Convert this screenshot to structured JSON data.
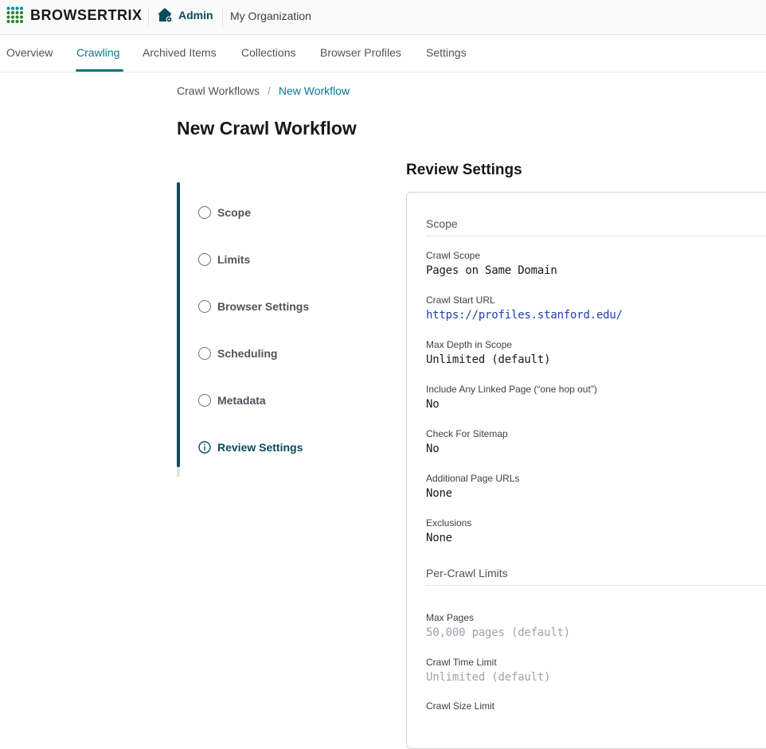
{
  "header": {
    "brand": "BROWSERTRIX",
    "admin_label": "Admin",
    "org_name": "My Organization"
  },
  "nav": {
    "tabs": [
      {
        "label": "Overview"
      },
      {
        "label": "Crawling"
      },
      {
        "label": "Archived Items"
      },
      {
        "label": "Collections"
      },
      {
        "label": "Browser Profiles"
      },
      {
        "label": "Settings"
      }
    ],
    "active": "Crawling"
  },
  "breadcrumb": {
    "parent": "Crawl Workflows",
    "separator": "/",
    "current": "New Workflow"
  },
  "page_title": "New Crawl Workflow",
  "steps": [
    {
      "label": "Scope",
      "state": "incomplete"
    },
    {
      "label": "Limits",
      "state": "incomplete"
    },
    {
      "label": "Browser Settings",
      "state": "incomplete"
    },
    {
      "label": "Scheduling",
      "state": "incomplete"
    },
    {
      "label": "Metadata",
      "state": "incomplete"
    },
    {
      "label": "Review Settings",
      "state": "current"
    }
  ],
  "review": {
    "heading": "Review Settings",
    "scope": {
      "title": "Scope",
      "fields": [
        {
          "label": "Crawl Scope",
          "value": "Pages on Same Domain"
        },
        {
          "label": "Crawl Start URL",
          "value": "https://profiles.stanford.edu/"
        },
        {
          "label": "Max Depth in Scope",
          "value": "Unlimited (default)"
        },
        {
          "label": "Include Any Linked Page (“one hop out”)",
          "value": "No"
        },
        {
          "label": "Check For Sitemap",
          "value": "No"
        },
        {
          "label": "Additional Page URLs",
          "value": "None"
        },
        {
          "label": "Exclusions",
          "value": "None"
        }
      ]
    },
    "limits": {
      "title": "Per-Crawl Limits",
      "fields": [
        {
          "label": "Max Pages",
          "value": "50,000 pages (default)"
        },
        {
          "label": "Crawl Time Limit",
          "value": "Unlimited (default)"
        },
        {
          "label": "Crawl Size Limit",
          "value": ""
        }
      ]
    }
  },
  "colors": {
    "accent": "#0e7490",
    "dark_teal": "#0a4b5c",
    "link": "#1e40af"
  }
}
